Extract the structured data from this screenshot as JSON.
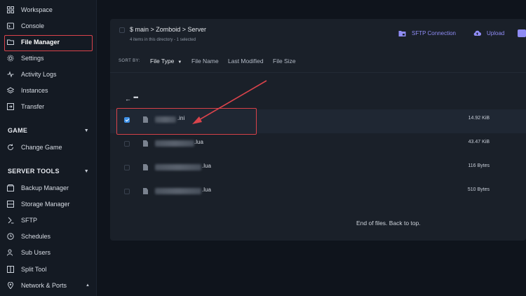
{
  "sidebar": {
    "items_top": [
      {
        "label": "Workspace",
        "icon": "grid-icon"
      },
      {
        "label": "Console",
        "icon": "terminal-icon"
      },
      {
        "label": "File Manager",
        "icon": "folder-icon"
      },
      {
        "label": "Settings",
        "icon": "gear-icon"
      },
      {
        "label": "Activity Logs",
        "icon": "activity-icon"
      },
      {
        "label": "Instances",
        "icon": "layers-icon"
      },
      {
        "label": "Transfer",
        "icon": "transfer-icon"
      }
    ],
    "game_title": "GAME",
    "game_items": [
      {
        "label": "Change Game",
        "icon": "refresh-icon"
      }
    ],
    "server_tools_title": "SERVER TOOLS",
    "server_tools_items": [
      {
        "label": "Backup Manager",
        "icon": "backup-icon"
      },
      {
        "label": "Storage Manager",
        "icon": "storage-icon"
      },
      {
        "label": "SFTP",
        "icon": "sftp-icon"
      },
      {
        "label": "Schedules",
        "icon": "clock-icon"
      },
      {
        "label": "Sub Users",
        "icon": "users-icon"
      },
      {
        "label": "Split Tool",
        "icon": "split-icon"
      },
      {
        "label": "Network & Ports",
        "icon": "location-icon"
      }
    ]
  },
  "header": {
    "path": "$ main > Zomboid > Server",
    "subtitle": "4 items in this directory - 1 selected",
    "sftp_label": "SFTP Connection",
    "upload_label": "Upload"
  },
  "sort": {
    "label": "SORT BY:",
    "options": [
      "File Type",
      "File Name",
      "Last Modified",
      "File Size"
    ]
  },
  "files": [
    {
      "ext": ".ini",
      "size": "14.92 KiB",
      "selected": true
    },
    {
      "ext": ".lua",
      "size": "43.47 KiB",
      "selected": false
    },
    {
      "ext": ".lua",
      "size": "116 Bytes",
      "selected": false
    },
    {
      "ext": ".lua",
      "size": "510 Bytes",
      "selected": false
    }
  ],
  "footer_note": "End of files. Back to top.",
  "colors": {
    "accent": "#8f8cf5",
    "highlight": "#d9434b",
    "checkbox": "#3d8fe6"
  }
}
